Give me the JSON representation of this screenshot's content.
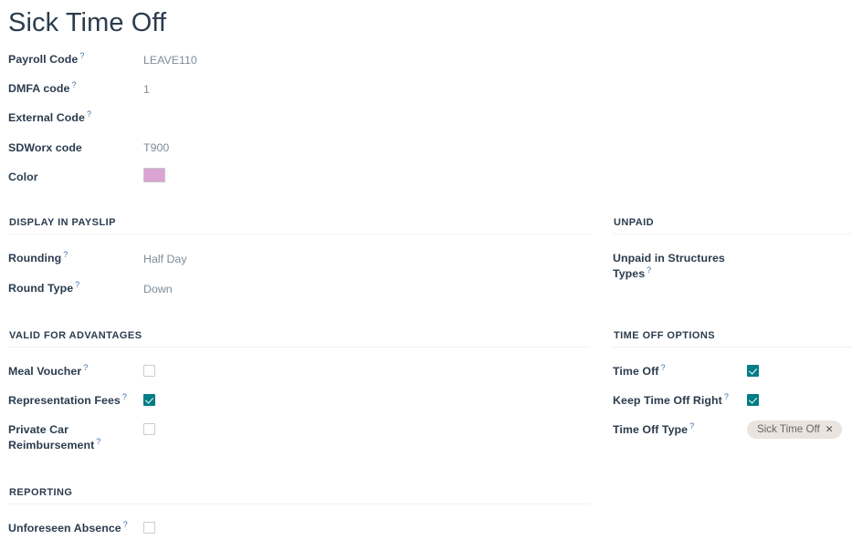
{
  "header": {
    "title": "Sick Time Off"
  },
  "theme": {
    "title_color": "#2b3c4e",
    "label_color": "#2b3c4e",
    "value_color": "#7f8c99",
    "help_marker_color": "#3d6ea8",
    "checkbox_checked_color": "#017d85",
    "checkbox_border_color": "#c9cdd2",
    "rule_color": "#f1f2f4",
    "tag_background": "#ebe3dd",
    "tag_text_color": "#6b6763",
    "color_swatch_value": "#dca4d4",
    "page_background": "#ffffff"
  },
  "help_marker": "?",
  "top_fields": [
    {
      "label": "Payroll Code",
      "help": true,
      "value": "LEAVE110"
    },
    {
      "label": "DMFA code",
      "help": true,
      "value": "1"
    },
    {
      "label": "External Code",
      "help": true,
      "value": ""
    },
    {
      "label": "SDWorx code",
      "help": false,
      "value": "T900"
    },
    {
      "label": "Color",
      "help": false,
      "value": ""
    }
  ],
  "color_field": {
    "label": "Color",
    "swatch_color": "#dca4d4",
    "swatch_name": "orchid"
  },
  "sections": {
    "display_in_payslip": {
      "title": "Display in Payslip",
      "fields": [
        {
          "label": "Rounding",
          "help": true,
          "value": "Half Day"
        },
        {
          "label": "Round Type",
          "help": true,
          "value": "Down"
        }
      ]
    },
    "unpaid": {
      "title": "Unpaid",
      "fields": [
        {
          "label": "Unpaid in Structures Types",
          "help": true,
          "value": ""
        }
      ]
    },
    "valid_for_advantages": {
      "title": "Valid for Advantages",
      "fields": [
        {
          "label": "Meal Voucher",
          "help": true,
          "checked": false
        },
        {
          "label": "Representation Fees",
          "help": true,
          "checked": true
        },
        {
          "label": "Private Car Reimbursement",
          "help": true,
          "checked": false
        }
      ]
    },
    "time_off_options": {
      "title": "Time Off Options",
      "fields": [
        {
          "label": "Time Off",
          "help": true,
          "checked": true
        },
        {
          "label": "Keep Time Off Right",
          "help": true,
          "checked": true
        }
      ],
      "time_off_type": {
        "label": "Time Off Type",
        "help": true,
        "tags": [
          {
            "text": "Sick Time Off",
            "remove": "✕"
          }
        ]
      }
    },
    "reporting": {
      "title": "Reporting",
      "fields": [
        {
          "label": "Unforeseen Absence",
          "help": true,
          "checked": false
        }
      ]
    }
  }
}
